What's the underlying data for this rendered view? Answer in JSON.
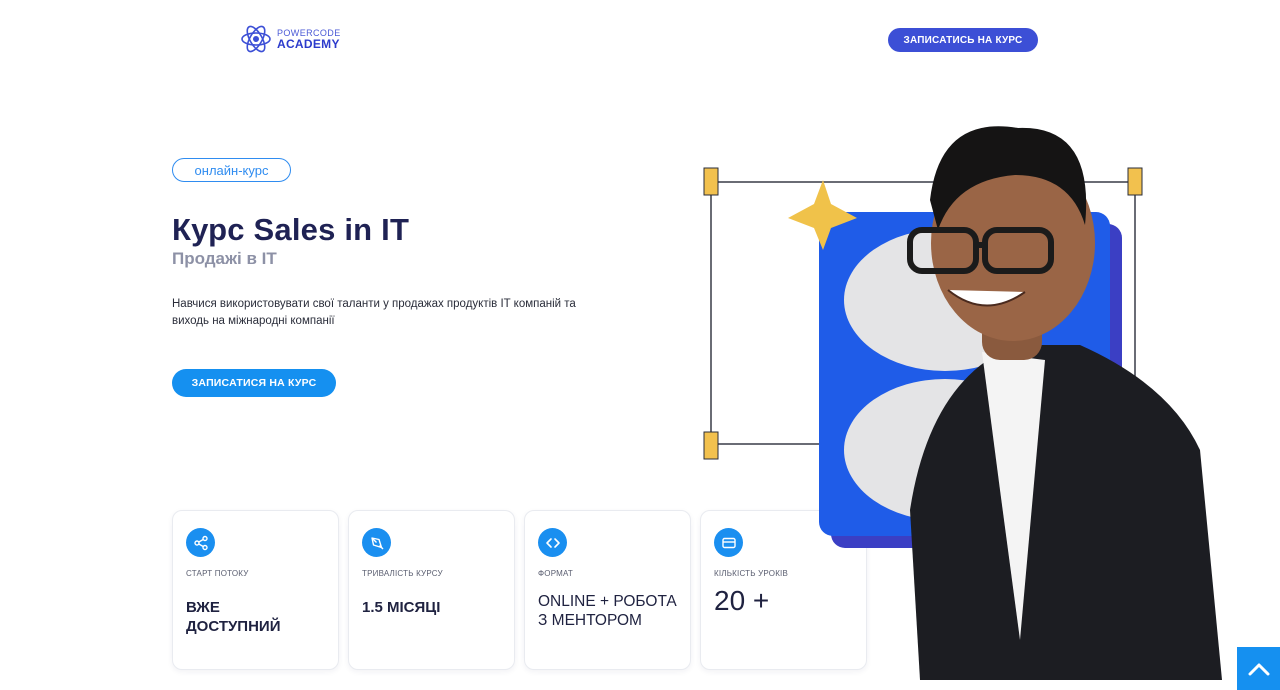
{
  "header": {
    "logo_top": "POWERCODE",
    "logo_bottom": "ACADEMY",
    "cta_label": "ЗАПИСАТИСЬ НА КУРС"
  },
  "hero": {
    "badge": "онлайн-курс",
    "title": "Курс Sales in IT",
    "subtitle": "Продажі в IT",
    "description": "Навчися використовувати свої таланти у продажах продуктів IT компаній та виходь на міжнародні компанії",
    "cta_label": "ЗАПИСАТИСЯ НА КУРС"
  },
  "cards": [
    {
      "icon": "share-icon",
      "label": "СТАРТ ПОТОКУ",
      "value": "ВЖЕ ДОСТУПНИЙ"
    },
    {
      "icon": "pen-tool-icon",
      "label": "ТРИВАЛІСТЬ КУРСУ",
      "value": "1.5 МІСЯЦІ"
    },
    {
      "icon": "code-icon",
      "label": "ФОРМАТ",
      "value": "ONLINE + РОБОТА З МЕНТОРОМ"
    },
    {
      "icon": "credit-card-icon",
      "label": "КІЛЬКІСТЬ УРОКІВ",
      "value": "20 +"
    }
  ],
  "colors": {
    "brand": "#3c4fd6",
    "accent": "#1590f0",
    "title": "#1f2254",
    "star": "#f0c24a"
  }
}
